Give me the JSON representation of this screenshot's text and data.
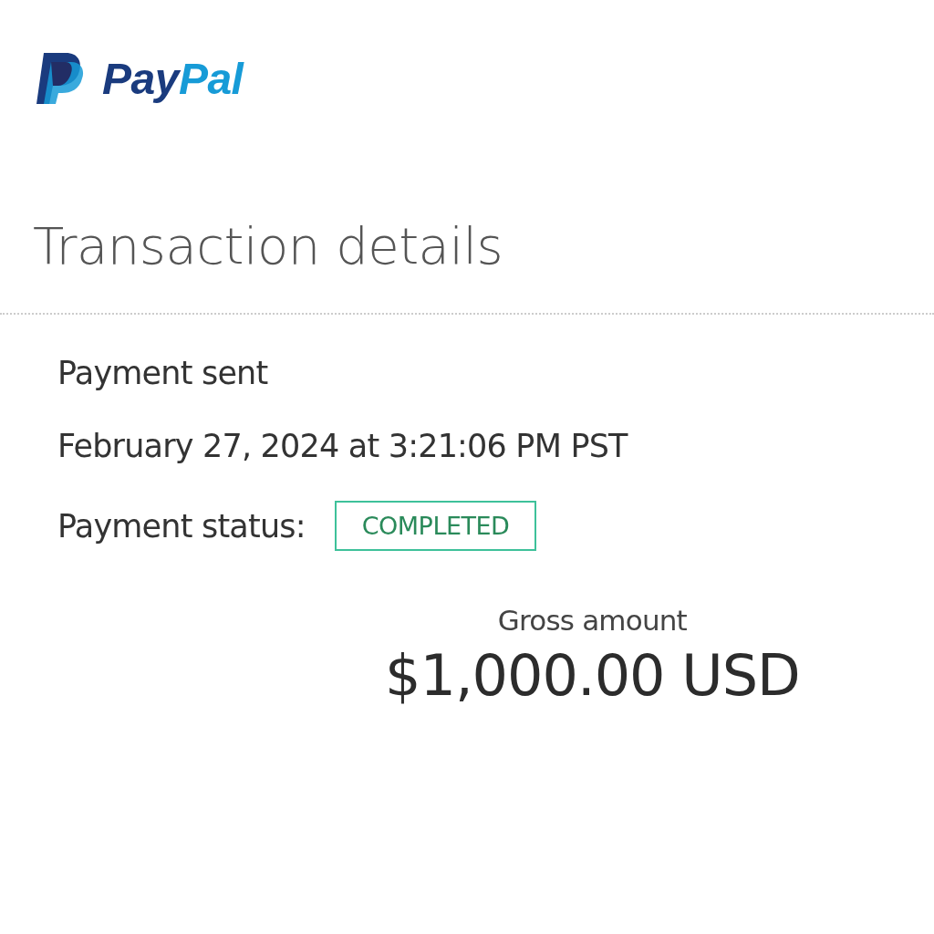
{
  "logo": {
    "brand_first": "Pay",
    "brand_second": "Pal"
  },
  "title": "Transaction details",
  "details": {
    "type": "Payment sent",
    "date": "February 27, 2024 at 3:21:06 PM PST",
    "status_label": "Payment status:",
    "status": "COMPLETED"
  },
  "amount": {
    "label": "Gross amount",
    "value": "$1,000.00 USD"
  }
}
